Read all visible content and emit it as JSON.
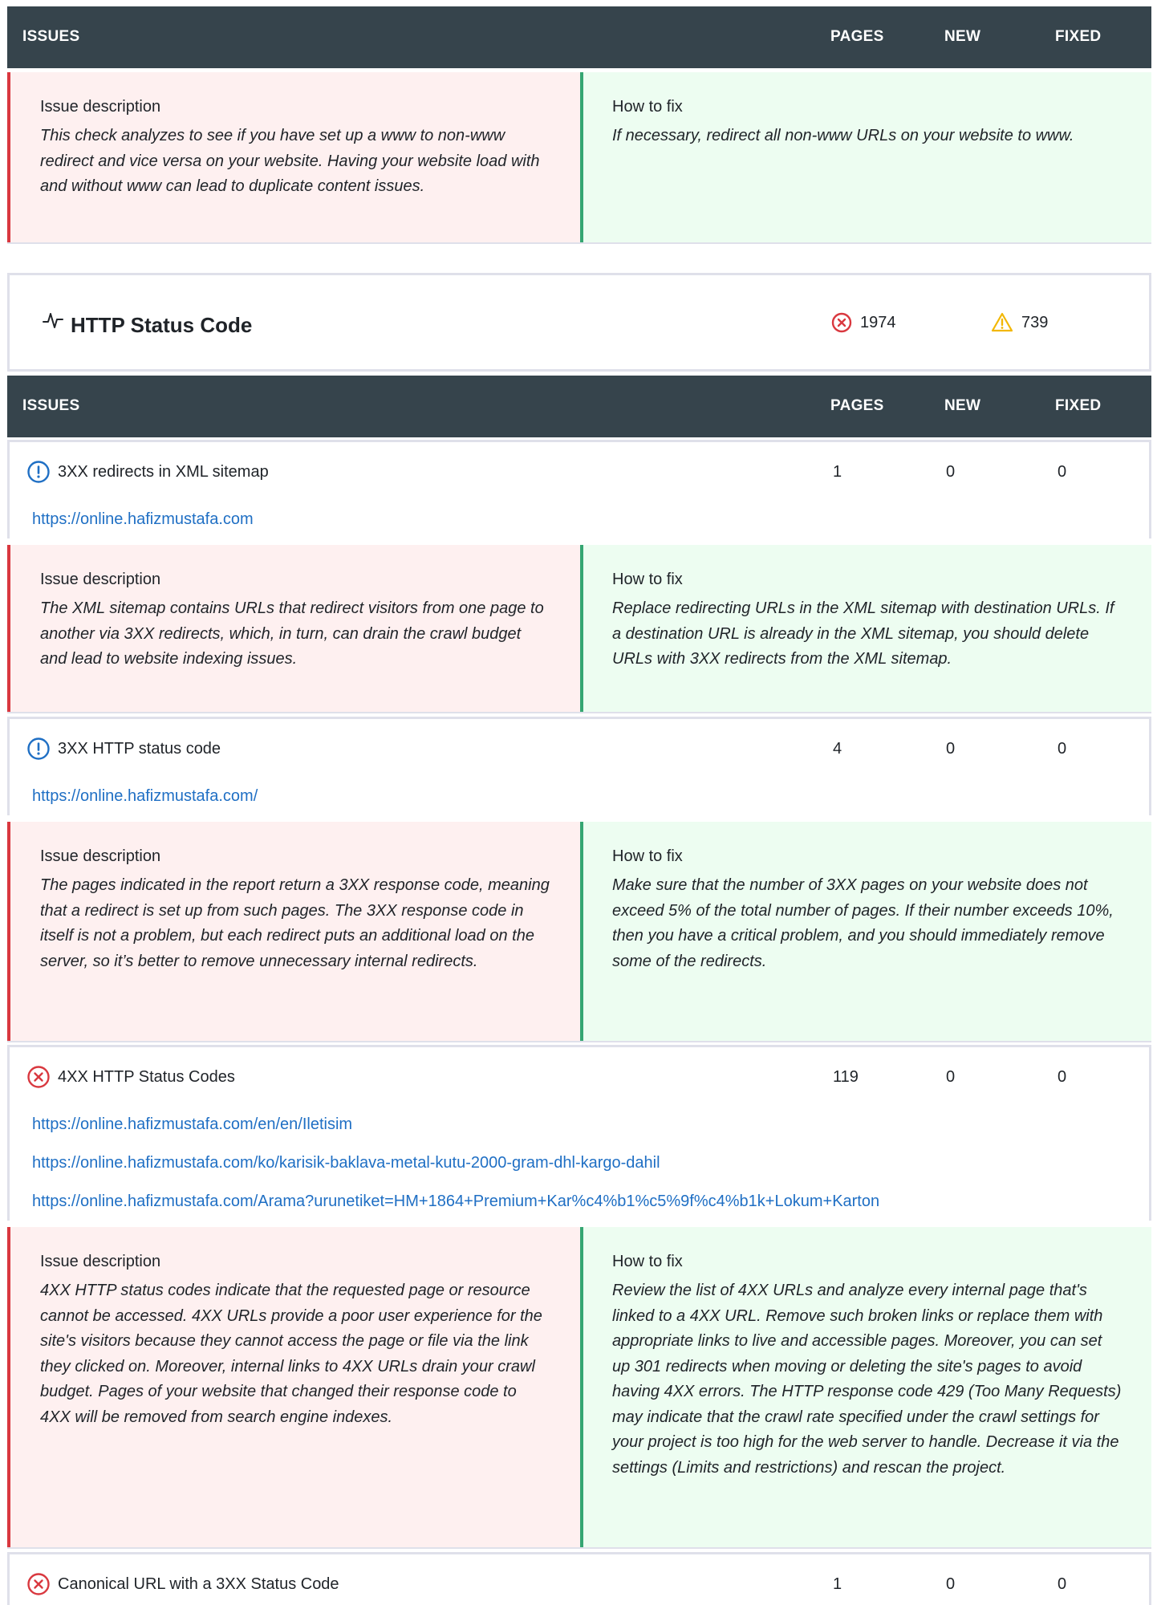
{
  "columns": {
    "issues": "ISSUES",
    "pages": "PAGES",
    "new": "NEW",
    "fixed": "FIXED"
  },
  "labels": {
    "issue_description": "Issue description",
    "how_to_fix": "How to fix"
  },
  "top_block": {
    "description": "This check analyzes to see if you have set up a www to non-www redirect and vice versa on your website. Having your website load with and without www can lead to duplicate content issues.",
    "fix": "If necessary, redirect all non-www URLs on your website to www."
  },
  "group": {
    "title": "HTTP Status Code",
    "icon": "pulse-icon",
    "errors": "1974",
    "warnings": "739",
    "colors": {
      "error": "#d9383f",
      "warning": "#f2b705",
      "info": "#1f6fc4"
    }
  },
  "issues": [
    {
      "name": "3XX redirects in XML sitemap",
      "severity": "info",
      "pages": "1",
      "new": "0",
      "fixed": "0",
      "urls": [
        "https://online.hafizmustafa.com"
      ],
      "description": "The XML sitemap contains URLs that redirect visitors from one page to another via 3XX redirects, which, in turn, can drain the crawl budget and lead to website indexing issues.",
      "fix": "Replace redirecting URLs in the XML sitemap with destination URLs. If a destination URL is already in the XML sitemap, you should delete URLs with 3XX redirects from the XML sitemap."
    },
    {
      "name": "3XX HTTP status code",
      "severity": "info",
      "pages": "4",
      "new": "0",
      "fixed": "0",
      "urls": [
        "https://online.hafizmustafa.com/"
      ],
      "description": "The pages indicated in the report return a 3XX response code, meaning that a redirect is set up from such pages. The 3XX response code in itself is not a problem, but each redirect puts an additional load on the server, so it’s better to remove unnecessary internal redirects.",
      "fix": "Make sure that the number of 3XX pages on your website does not exceed 5% of the total number of pages. If their number exceeds 10%, then you have a critical problem, and you should immediately remove some of the redirects."
    },
    {
      "name": "4XX HTTP Status Codes",
      "severity": "error",
      "pages": "119",
      "new": "0",
      "fixed": "0",
      "urls": [
        "https://online.hafizmustafa.com/en/en/Iletisim",
        "https://online.hafizmustafa.com/ko/karisik-baklava-metal-kutu-2000-gram-dhl-kargo-dahil",
        "https://online.hafizmustafa.com/Arama?urunetiket=HM+1864+Premium+Kar%c4%b1%c5%9f%c4%b1k+Lokum+Karton"
      ],
      "description": "4XX HTTP status codes indicate that the requested page or resource cannot be accessed. 4XX URLs provide a poor user experience for the site's visitors because they cannot access the page or file via the link they clicked on. Moreover, internal links to 4XX URLs drain your crawl budget. Pages of your website that changed their response code to 4XX will be removed from search engine indexes.",
      "fix": "Review the list of 4XX URLs and analyze every internal page that's linked to a 4XX URL. Remove such broken links or replace them with appropriate links to live and accessible pages. Moreover, you can set up 301 redirects when moving or deleting the site's pages to avoid having 4XX errors. The HTTP response code 429 (Too Many Requests) may indicate that the crawl rate specified under the crawl settings for your project is too high for the web server to handle. Decrease it via the settings (Limits and restrictions) and rescan the project."
    },
    {
      "name": "Canonical URL with a 3XX Status Code",
      "severity": "error",
      "pages": "1",
      "new": "0",
      "fixed": "0"
    }
  ]
}
